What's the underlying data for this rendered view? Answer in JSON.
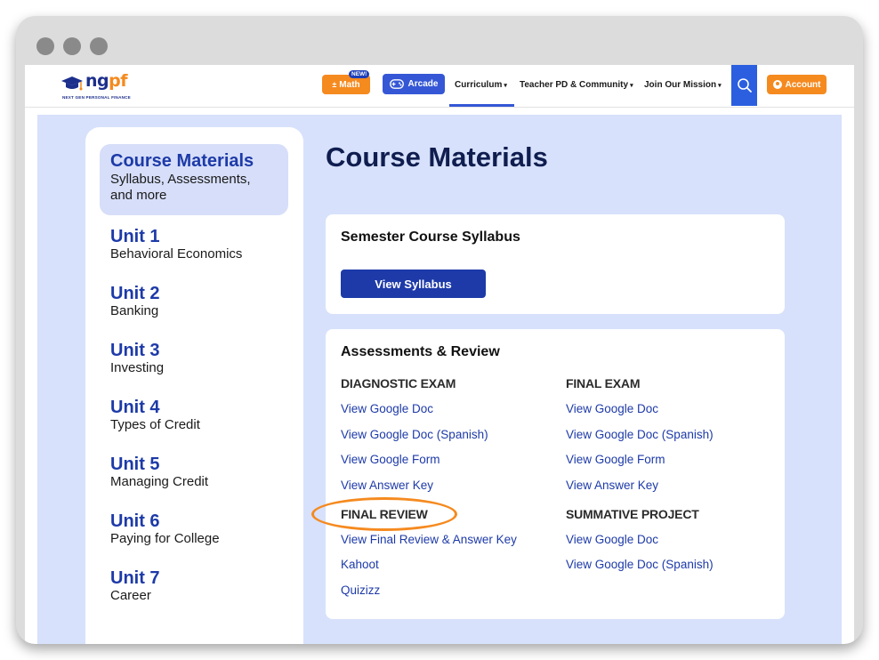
{
  "logo": {
    "text_n": "n",
    "text_g": "g",
    "text_p": "p",
    "text_f": "f",
    "tagline": "NEXT GEN PERSONAL FINANCE"
  },
  "nav": {
    "math_label": "Math",
    "new_badge": "NEW!",
    "arcade_label": "Arcade",
    "curriculum_label": "Curriculum",
    "teacher_label": "Teacher PD & Community",
    "mission_label": "Join Our Mission",
    "caret": "▾",
    "account_label": "Account"
  },
  "sidebar": {
    "active": {
      "title": "Course Materials",
      "sub_line1": "Syllabus, Assessments,",
      "sub_line2": "and more"
    },
    "units": [
      {
        "title": "Unit 1",
        "sub": "Behavioral Economics"
      },
      {
        "title": "Unit 2",
        "sub": "Banking"
      },
      {
        "title": "Unit 3",
        "sub": "Investing"
      },
      {
        "title": "Unit 4",
        "sub": "Types of Credit"
      },
      {
        "title": "Unit 5",
        "sub": "Managing Credit"
      },
      {
        "title": "Unit 6",
        "sub": "Paying for College"
      },
      {
        "title": "Unit 7",
        "sub": "Career"
      }
    ]
  },
  "main": {
    "title": "Course Materials",
    "syllabus": {
      "title": "Semester Course Syllabus",
      "button": "View Syllabus"
    },
    "assessments": {
      "title": "Assessments & Review",
      "diagnostic": {
        "heading": "DIAGNOSTIC EXAM",
        "links": [
          "View Google Doc",
          "View Google Doc (Spanish)",
          "View Google Form",
          "View Answer Key"
        ]
      },
      "final_exam": {
        "heading": "FINAL EXAM",
        "links": [
          "View Google Doc",
          "View Google Doc (Spanish)",
          "View Google Form",
          "View Answer Key"
        ]
      },
      "final_review": {
        "heading": "FINAL REVIEW",
        "links": [
          "View Final Review & Answer Key",
          "Kahoot",
          "Quizizz"
        ]
      },
      "summative": {
        "heading": "SUMMATIVE PROJECT",
        "links": [
          "View Google Doc",
          "View Google Doc (Spanish)"
        ]
      }
    }
  },
  "colors": {
    "brand_blue": "#1d3aa8",
    "brand_orange": "#f58a1f",
    "content_bg": "#d7e1fb"
  }
}
